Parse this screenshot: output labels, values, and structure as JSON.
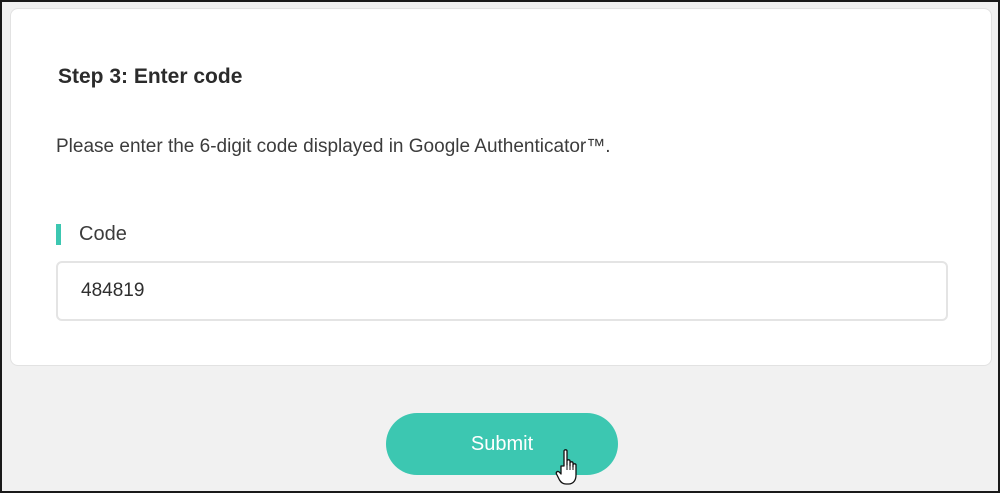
{
  "step": {
    "title": "Step 3: Enter code",
    "instructions": "Please enter the 6-digit code displayed in Google Authenticator™."
  },
  "code_field": {
    "label": "Code",
    "value": "484819"
  },
  "submit": {
    "label": "Submit"
  },
  "colors": {
    "accent": "#3cc7b1",
    "page_background": "#f1f1f1",
    "card_background": "#ffffff"
  },
  "icons": {
    "cursor": "hand-pointer-icon"
  }
}
